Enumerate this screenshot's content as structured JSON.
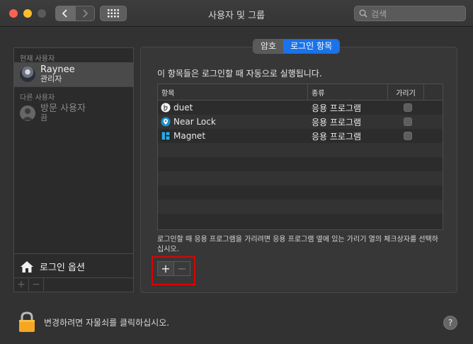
{
  "window": {
    "title": "사용자 및 그룹"
  },
  "search": {
    "placeholder": "검색"
  },
  "sidebar": {
    "current_header": "현재 사용자",
    "current_user": {
      "name": "Raynee",
      "role": "관리자"
    },
    "other_header": "다른 사용자",
    "guest_user": {
      "name": "방문 사용자",
      "role": "끔"
    },
    "login_options_label": "로그인 옵션",
    "add_label": "+",
    "remove_label": "−"
  },
  "tabs": [
    {
      "label": "암호",
      "active": false
    },
    {
      "label": "로그인 항목",
      "active": true
    }
  ],
  "main": {
    "intro": "이 항목들은 로그인할 때 자동으로 실행됩니다.",
    "columns": {
      "item": "항목",
      "kind": "종류",
      "hide": "가리기"
    },
    "rows": [
      {
        "name": "duet",
        "kind": "응용 프로그램",
        "hidden": false,
        "icon": "duet-app-icon"
      },
      {
        "name": "Near Lock",
        "kind": "응용 프로그램",
        "hidden": false,
        "icon": "near-lock-app-icon"
      },
      {
        "name": "Magnet",
        "kind": "응용 프로그램",
        "hidden": false,
        "icon": "magnet-app-icon"
      }
    ],
    "note": "로그인할 때 응용 프로그램을 가리려면 응용 프로그램 옆에 있는 가리기 열의 체크상자를 선택하십시오.",
    "add_label": "+",
    "remove_label": "−"
  },
  "footer": {
    "lock_text": "변경하려면 자물쇠를 클릭하십시오.",
    "help_label": "?"
  },
  "colors": {
    "accent": "#1a73e8",
    "highlight": "#e00000",
    "background": "#323232"
  }
}
